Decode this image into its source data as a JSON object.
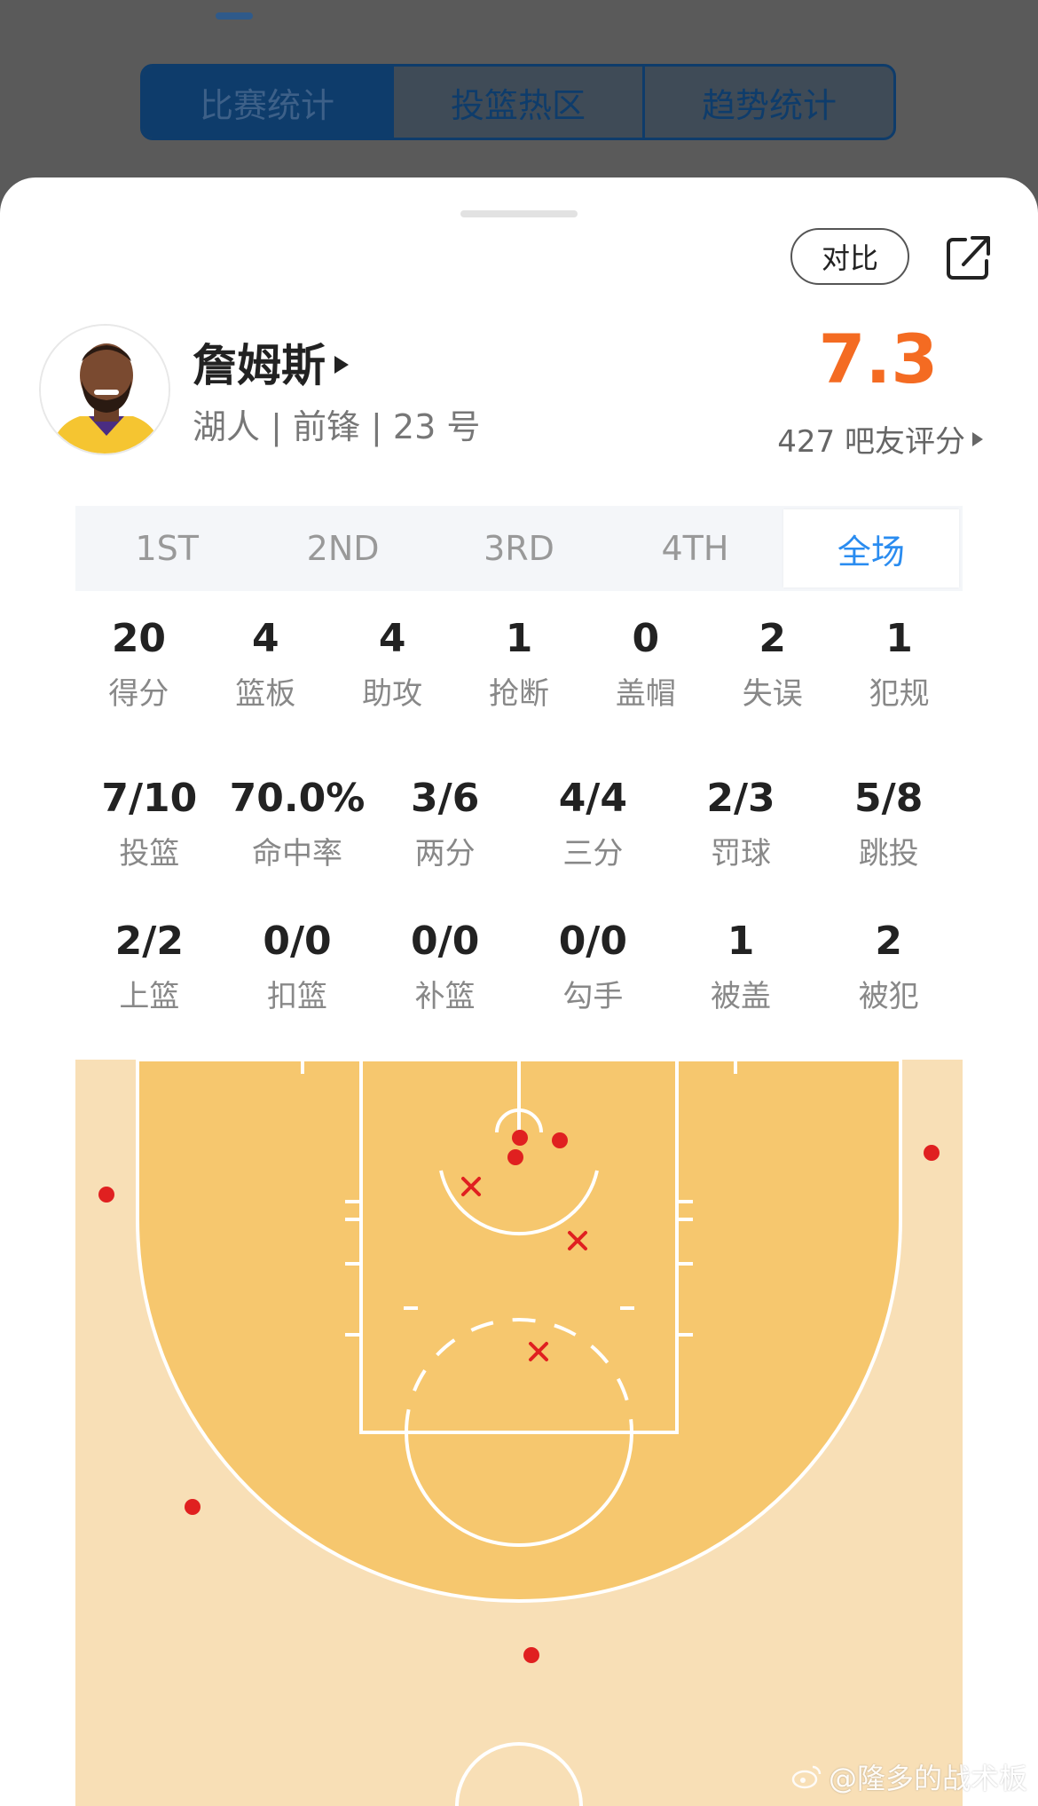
{
  "tabs": [
    {
      "label": "比赛统计",
      "active": true
    },
    {
      "label": "投篮热区",
      "active": false
    },
    {
      "label": "趋势统计",
      "active": false
    }
  ],
  "compare_label": "对比",
  "player": {
    "name": "詹姆斯",
    "meta": "湖人 | 前锋 | 23 号",
    "rating": "7.3",
    "rating_count": "427 吧友评分"
  },
  "periods": [
    {
      "label": "1ST",
      "active": false
    },
    {
      "label": "2ND",
      "active": false
    },
    {
      "label": "3RD",
      "active": false
    },
    {
      "label": "4TH",
      "active": false
    },
    {
      "label": "全场",
      "active": true
    }
  ],
  "stats_row1": [
    {
      "value": "20",
      "label": "得分"
    },
    {
      "value": "4",
      "label": "篮板"
    },
    {
      "value": "4",
      "label": "助攻"
    },
    {
      "value": "1",
      "label": "抢断"
    },
    {
      "value": "0",
      "label": "盖帽"
    },
    {
      "value": "2",
      "label": "失误"
    },
    {
      "value": "1",
      "label": "犯规"
    }
  ],
  "stats_row2": [
    {
      "value": "7/10",
      "label": "投篮"
    },
    {
      "value": "70.0%",
      "label": "命中率"
    },
    {
      "value": "3/6",
      "label": "两分"
    },
    {
      "value": "4/4",
      "label": "三分"
    },
    {
      "value": "2/3",
      "label": "罚球"
    },
    {
      "value": "5/8",
      "label": "跳投"
    }
  ],
  "stats_row3": [
    {
      "value": "2/2",
      "label": "上篮"
    },
    {
      "value": "0/0",
      "label": "扣篮"
    },
    {
      "value": "0/0",
      "label": "补篮"
    },
    {
      "value": "0/0",
      "label": "勾手"
    },
    {
      "value": "1",
      "label": "被盖"
    },
    {
      "value": "2",
      "label": "被犯"
    }
  ],
  "colors": {
    "accent_blue": "#2a8cf0",
    "rating_orange": "#f46b22",
    "court_inner": "#f6c76e",
    "court_outer": "#f8dfb6",
    "made_dot": "#e02020",
    "missed_x": "#e02020"
  },
  "watermark": "@隆多的战术板"
}
